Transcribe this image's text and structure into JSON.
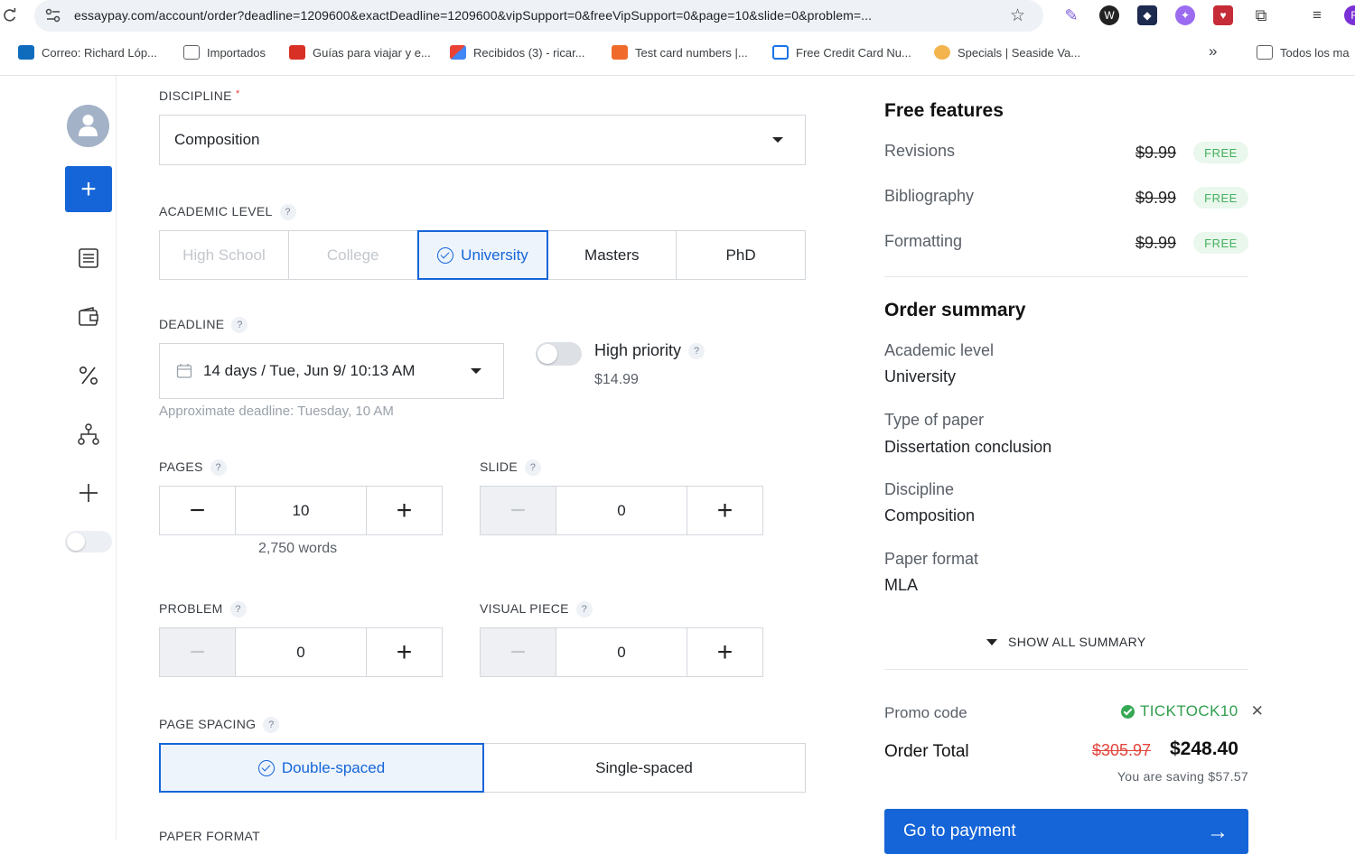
{
  "browser": {
    "url": "essaypay.com/account/order?deadline=1209600&exactDeadline=1209600&vipSupport=0&freeVipSupport=0&page=10&slide=0&problem=...",
    "bookmarks": [
      {
        "label": "Correo: Richard Lóp...",
        "icon": "outlook-icon",
        "color": "#0f6cbd"
      },
      {
        "label": "Importados",
        "icon": "folder-icon",
        "color": "#5f6368"
      },
      {
        "label": "Guías para viajar y e...",
        "icon": "travel-icon",
        "color": "#d93025"
      },
      {
        "label": "Recibidos (3) - ricar...",
        "icon": "gmail-icon",
        "color": "#ea4335"
      },
      {
        "label": "Test card numbers |...",
        "icon": "card-icon",
        "color": "#f06b2b"
      },
      {
        "label": "Free Credit Card Nu...",
        "icon": "card-icon",
        "color": "#1a73e8"
      },
      {
        "label": "Specials | Seaside Va...",
        "icon": "seaside-icon",
        "color": "#f3b44d"
      }
    ],
    "more_bookmarks": "»",
    "all_bookmarks": "Todos los ma"
  },
  "form": {
    "discipline_label": "DISCIPLINE",
    "discipline_required": "*",
    "discipline_value": "Composition",
    "academic_label": "ACADEMIC LEVEL",
    "levels": [
      "High School",
      "College",
      "University",
      "Masters",
      "PhD"
    ],
    "deadline_label": "DEADLINE",
    "deadline_value": "14 days / Tue, Jun 9/ 10:13 AM",
    "approx_deadline": "Approximate deadline: Tuesday, 10 AM",
    "high_priority_label": "High priority",
    "high_priority_price": "$14.99",
    "pages_label": "PAGES",
    "pages_value": "10",
    "words": "2,750 words",
    "slide_label": "SLIDE",
    "slide_value": "0",
    "problem_label": "PROBLEM",
    "problem_value": "0",
    "visual_label": "VISUAL PIECE",
    "visual_value": "0",
    "spacing_label": "PAGE SPACING",
    "spacing_double": "Double-spaced",
    "spacing_single": "Single-spaced",
    "paper_format_label": "PAPER FORMAT",
    "help": "?"
  },
  "summary": {
    "free_title": "Free features",
    "free_items": [
      {
        "label": "Revisions",
        "price": "$9.99",
        "badge": "FREE"
      },
      {
        "label": "Bibliography",
        "price": "$9.99",
        "badge": "FREE"
      },
      {
        "label": "Formatting",
        "price": "$9.99",
        "badge": "FREE"
      }
    ],
    "order_title": "Order summary",
    "rows": [
      {
        "label": "Academic level",
        "value": "University"
      },
      {
        "label": "Type of paper",
        "value": "Dissertation conclusion"
      },
      {
        "label": "Discipline",
        "value": "Composition"
      },
      {
        "label": "Paper format",
        "value": "MLA"
      }
    ],
    "show_all": "SHOW ALL SUMMARY",
    "promo_label": "Promo code",
    "promo_code": "TICKTOCK10",
    "total_label": "Order Total",
    "old_total": "$305.97",
    "new_total": "$248.40",
    "saving": "You are saving $57.57",
    "pay_button": "Go to payment"
  },
  "colors": {
    "accent": "#1565d8",
    "free": "#45b05e",
    "old_price": "#e2453c"
  }
}
